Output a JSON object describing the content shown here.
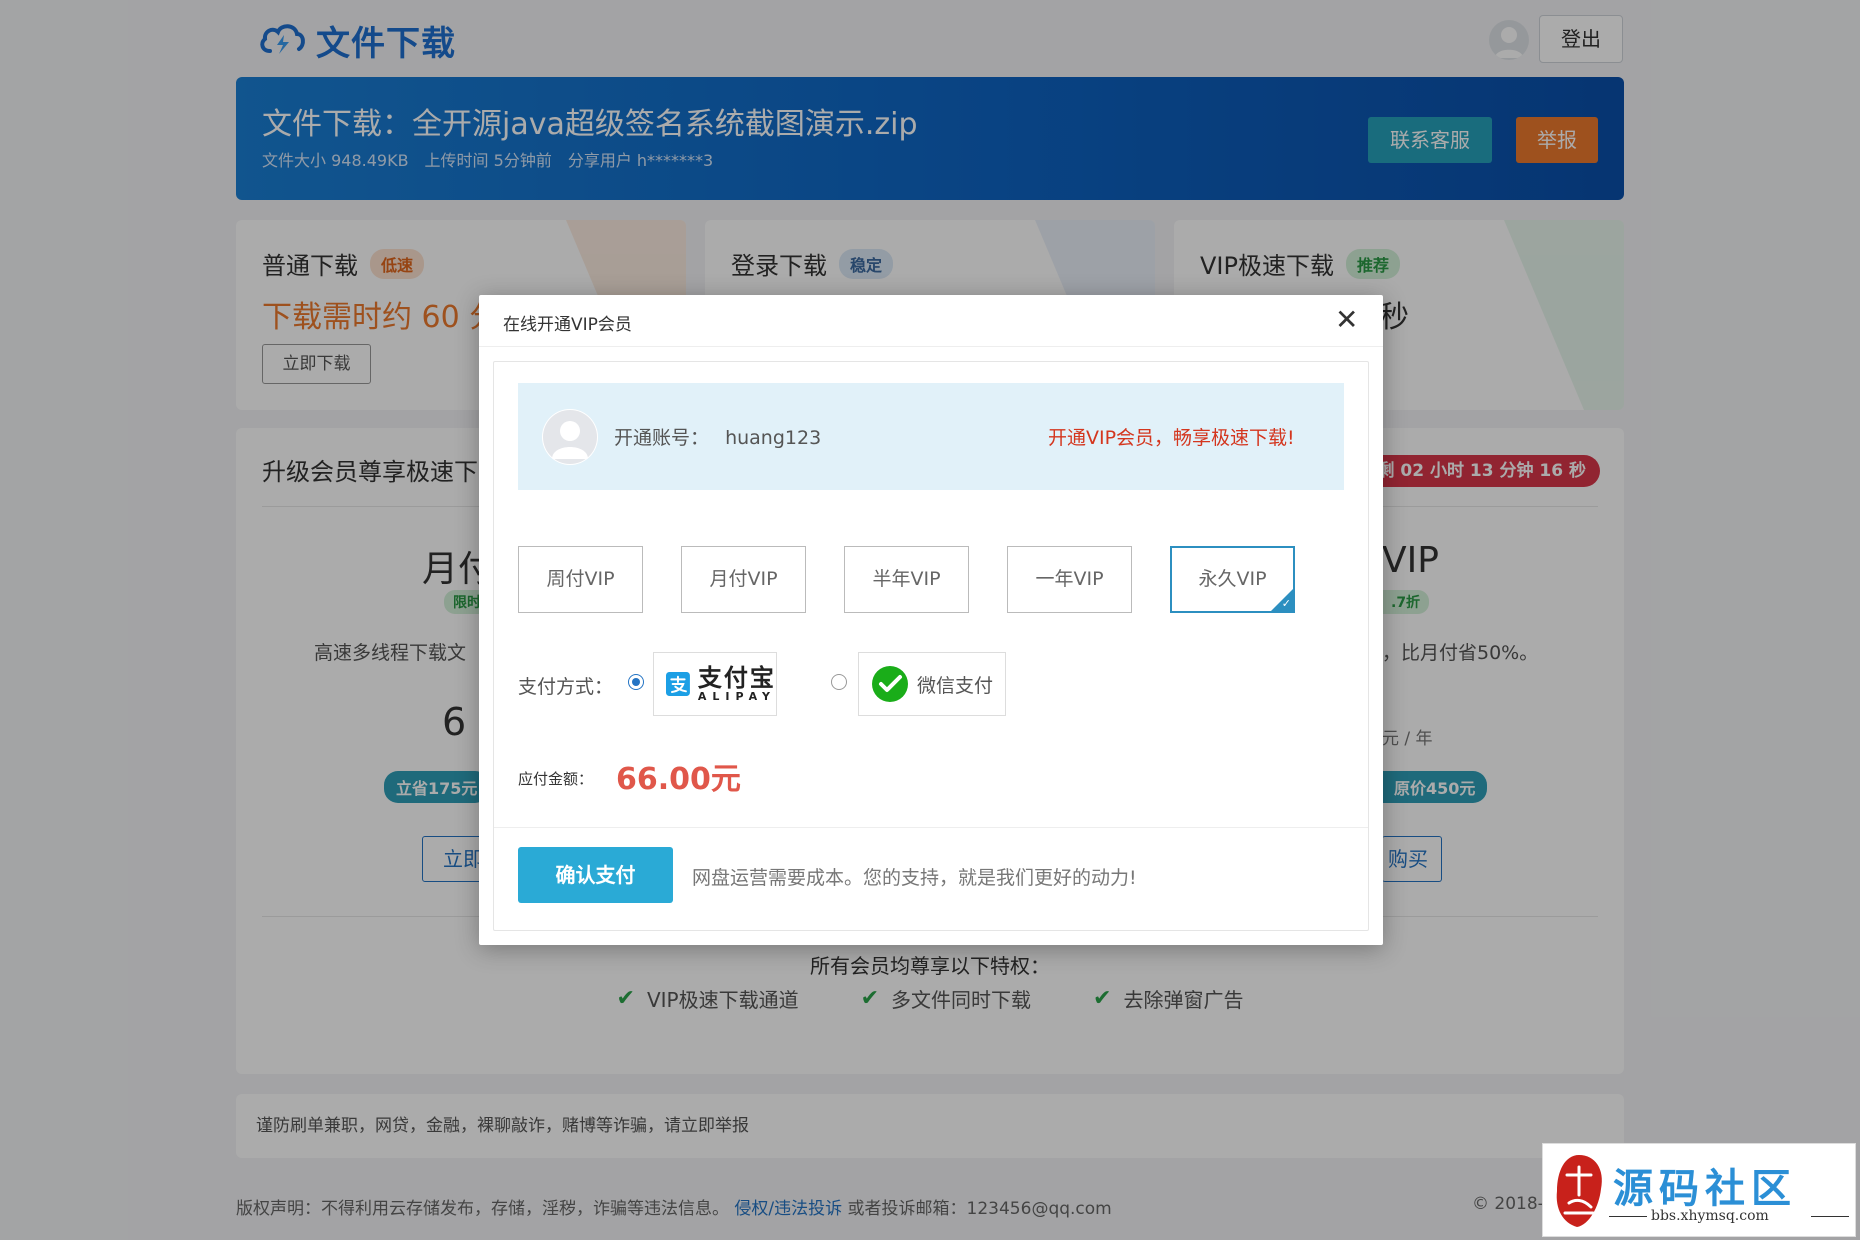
{
  "header": {
    "logo_text": "文件下载",
    "logout_label": "登出"
  },
  "file": {
    "title": "文件下载：全开源java超级签名系统截图演示.zip",
    "size": "文件大小 948.49KB",
    "uploaded": "上传时间 5分钟前",
    "sharer": "分享用户 h*******3",
    "service_label": "联系客服",
    "report_label": "举报"
  },
  "download_cards": [
    {
      "title": "普通下载",
      "tag": "低速",
      "time": "下载需时约 60 分",
      "button": "立即下载"
    },
    {
      "title": "登录下载",
      "tag": "稳定"
    },
    {
      "title": "VIP极速下载",
      "tag": "推荐",
      "time_fragment": "秒"
    }
  ],
  "vip_section": {
    "heading": "升级会员尊享极速下",
    "countdown": "剩 02 小时 13 分钟 16 秒",
    "left_plan": {
      "name": "月付",
      "tag": "限时",
      "desc": "高速多线程下载文",
      "price": "6",
      "save": "立省175元",
      "button": "立即"
    },
    "right_plan": {
      "name": "VIP",
      "tag": ".7折",
      "desc": "，比月付省50%。",
      "unit": "元 / 年",
      "save": "原价450元",
      "button": "购买"
    },
    "privileges_title": "所有会员均尊享以下特权：",
    "privileges": [
      "VIP极速下载通道",
      "多文件同时下载",
      "去除弹窗广告"
    ]
  },
  "notice": "谨防刷单兼职，网贷，金融，裸聊敲诈，赌博等诈骗，请立即举报",
  "footer": {
    "text": "版权声明：不得利用云存储发布，存储，淫秽，诈骗等违法信息。",
    "link": "侵权/违法投诉",
    "email": "或者投诉邮箱：123456@qq.com",
    "copyright": "© 2018-2"
  },
  "modal": {
    "title": "在线开通VIP会员",
    "close": "✕",
    "account_label": "开通账号：",
    "account_name": "huang123",
    "promo": "开通VIP会员，畅享极速下载!",
    "vip_options": [
      "周付VIP",
      "月付VIP",
      "半年VIP",
      "一年VIP",
      "永久VIP"
    ],
    "selected_option": "永久VIP",
    "pay_label": "支付方式：",
    "alipay_cn": "支付宝",
    "alipay_en": "ALIPAY",
    "wechat_label": "微信支付",
    "selected_payment": "alipay",
    "amount_label": "应付金额：",
    "amount": "66.00元",
    "confirm_label": "确认支付",
    "confirm_note": "网盘运营需要成本。您的支持，就是我们更好的动力!"
  },
  "watermark": {
    "text": "源码社区",
    "url": "bbs.xhymsq.com",
    "seal": "小红"
  },
  "colors": {
    "brand_blue": "#1e6fcf",
    "banner_blue": "#0e64c3",
    "accent_orange": "#ec7a2e",
    "teal": "#26a2bb",
    "confirm_blue": "#2aaad6",
    "price_red": "#e0574a",
    "promo_red": "#d4361e"
  }
}
